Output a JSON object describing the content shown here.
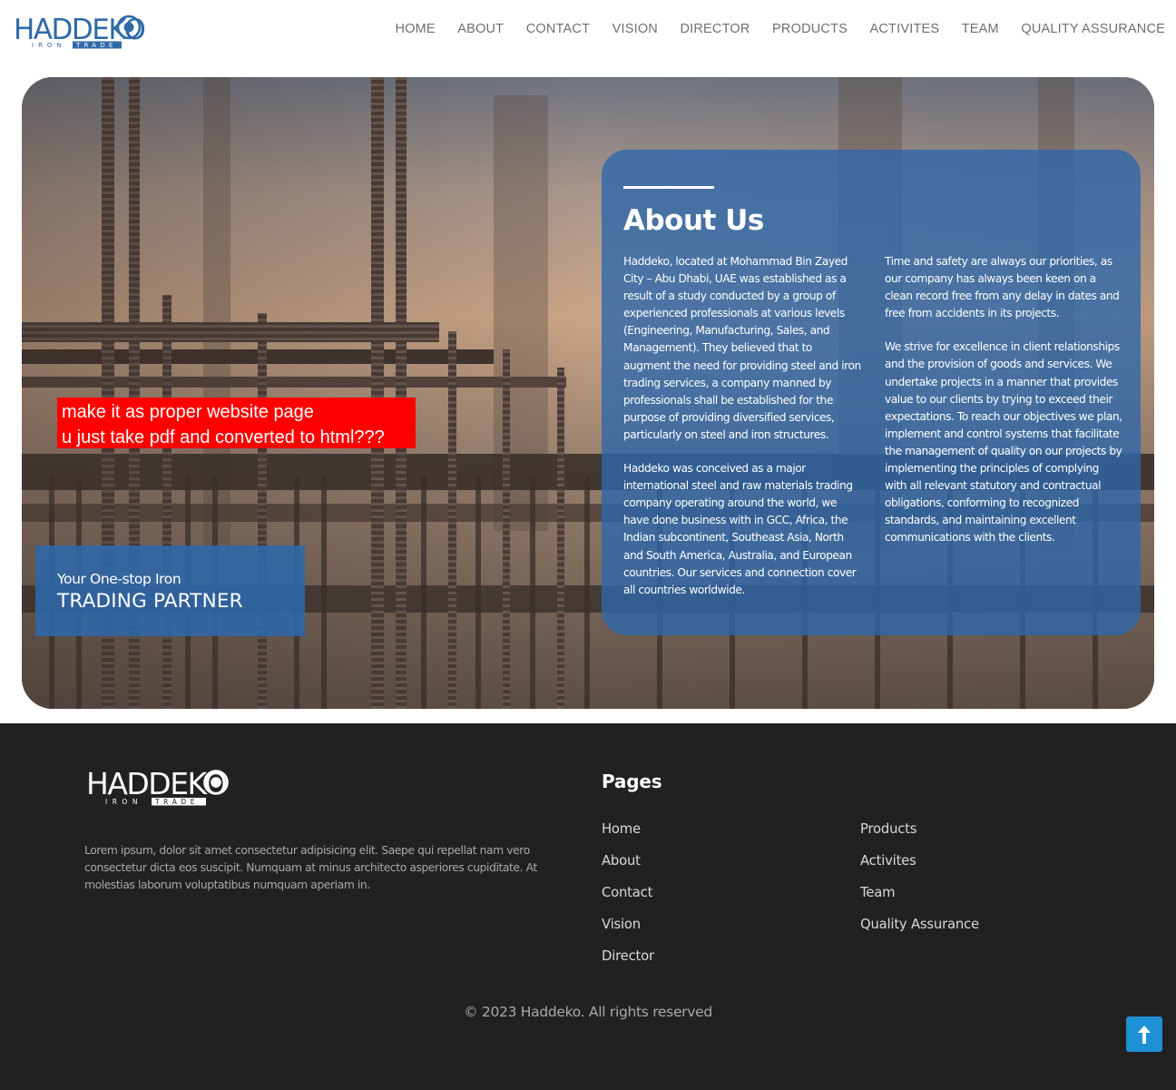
{
  "header": {
    "logo": {
      "name": "HADDEKO",
      "sub_left": "IRON",
      "sub_right": "TRADE",
      "color": "#2e6aa8"
    },
    "nav": [
      "HOME",
      "ABOUT",
      "CONTACT",
      "VISION",
      "DIRECTOR",
      "PRODUCTS",
      "ACTIVITES",
      "TEAM",
      "QUALITY ASSURANCE"
    ]
  },
  "hero": {
    "about": {
      "title": "About Us",
      "left": [
        "Haddeko, located at Mohammad Bin Zayed City – Abu Dhabi, UAE was established as a result of a study conducted by a group of experienced professionals at various levels (Engineering, Manufacturing, Sales, and Management). They believed that to augment the need for providing steel and iron trading services, a company manned by professionals shall be established for the purpose of providing diversified services, particularly on steel and iron structures.",
        "Haddeko was conceived as a major international steel and raw materials trading company operating around the world, we have done business with in GCC, Africa, the Indian subcontinent, Southeast Asia, North and South America, Australia, and European countries. Our services and connection cover all countries worldwide."
      ],
      "right": [
        "Time and safety are always our priorities, as our company has always been keen on a clean record free from any delay in dates and free from accidents in its projects.",
        "We strive for excellence in client relationships and the provision of goods and services. We undertake projects in a manner that provides value to our clients by trying to exceed their expectations. To reach our objectives we plan, implement and control systems that facilitate the management of quality on our projects by implementing the principles of complying with all relevant statutory and contractual obligations, conforming to recognized standards, and maintaining excellent communications with the clients."
      ]
    },
    "note": [
      "make it as proper website page",
      "u just take pdf and converted to html???"
    ],
    "tagline": {
      "small": "Your One-stop Iron",
      "big": "TRADING PARTNER"
    },
    "card_color": "#2e68aa"
  },
  "footer": {
    "logo": {
      "name": "HADDEKO",
      "sub_left": "IRON",
      "sub_right": "TRADE"
    },
    "description": "Lorem ipsum, dolor sit amet consectetur adipisicing elit. Saepe qui repellat nam vero consectetur dicta eos suscipit. Numquam at minus architecto asperiores cupiditate. At molestias laborum voluptatibus numquam aperiam in.",
    "pages_title": "Pages",
    "links_col1": [
      "Home",
      "About",
      "Contact",
      "Vision",
      "Director"
    ],
    "links_col2": [
      "Products",
      "Activites",
      "Team",
      "Quality Assurance"
    ],
    "copyright": "© 2023 Haddeko. All rights reserved",
    "to_top_icon": "arrow-up-icon",
    "to_top_color": "#1e90d6"
  }
}
